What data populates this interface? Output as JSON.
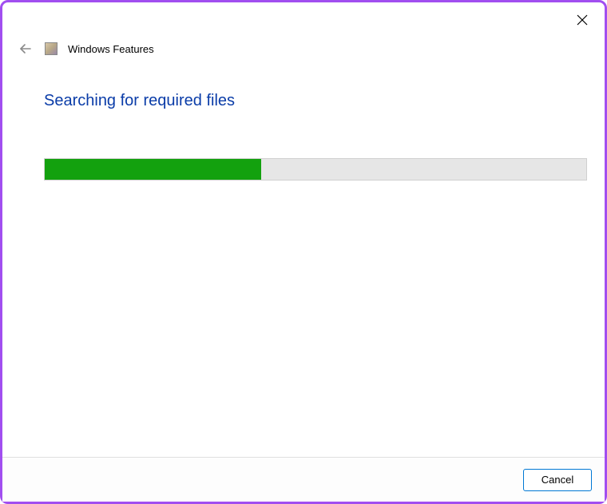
{
  "header": {
    "app_title": "Windows Features"
  },
  "main": {
    "heading": "Searching for required files",
    "progress_percent": 40
  },
  "footer": {
    "cancel_label": "Cancel"
  },
  "colors": {
    "accent_border": "#a14ef0",
    "heading_text": "#0a3ca8",
    "progress_fill": "#13a10e",
    "button_border": "#0078d4"
  }
}
